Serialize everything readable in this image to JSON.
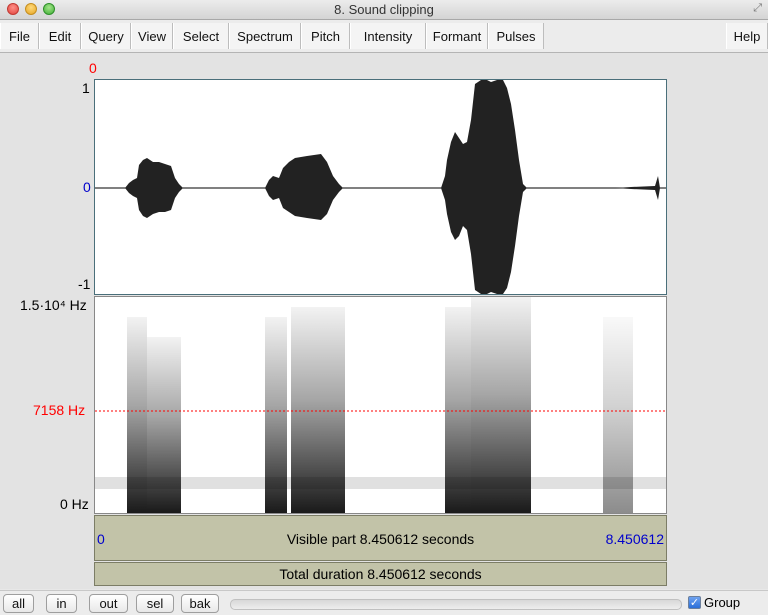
{
  "window": {
    "title": "8. Sound clipping"
  },
  "menu": {
    "items": [
      "File",
      "Edit",
      "Query",
      "View",
      "Select",
      "Spectrum",
      "Pitch",
      "Intensity",
      "Formant",
      "Pulses"
    ],
    "help": "Help"
  },
  "waveform": {
    "top_label": "0",
    "y_max": "1",
    "y_zero": "0",
    "y_min": "-1"
  },
  "spectrogram": {
    "y_max": "1.5·10⁴ Hz",
    "y_cursor": "7158 Hz",
    "y_min": "0 Hz"
  },
  "visible_row": {
    "start": "0",
    "text": "Visible part 8.450612 seconds",
    "end": "8.450612"
  },
  "total_row": {
    "text": "Total duration 8.450612 seconds"
  },
  "bottom": {
    "buttons": [
      "all",
      "in",
      "out",
      "sel",
      "bak"
    ],
    "group_label": "Group",
    "group_checked": true
  },
  "colors": {
    "cursor_red": "#ff0000",
    "blue_text": "#0000cc",
    "row_bg": "#c2c3a8"
  }
}
